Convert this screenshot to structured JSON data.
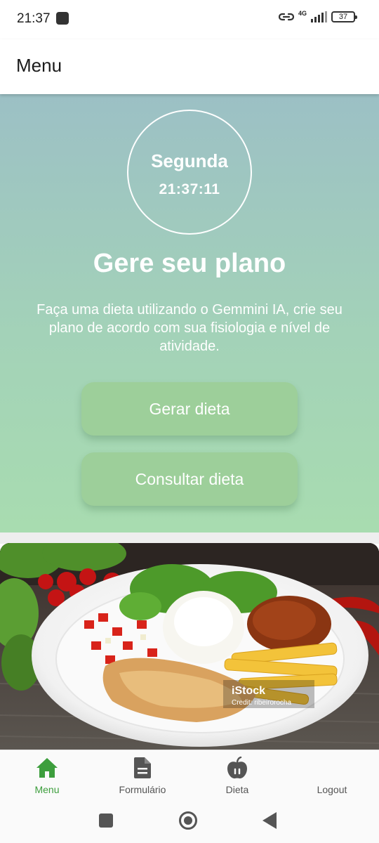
{
  "status_bar": {
    "time": "21:37",
    "network": "4G",
    "battery": "37"
  },
  "app_bar": {
    "title": "Menu"
  },
  "hero": {
    "day": "Segunda",
    "clock": "21:37:11",
    "title": "Gere seu plano",
    "description": "Faça uma dieta utilizando o Gemmini IA, crie seu plano de acordo com sua fisiologia e nível de atividade.",
    "buttons": {
      "generate": "Gerar dieta",
      "consult": "Consultar dieta"
    }
  },
  "food_image": {
    "watermark": "iStock",
    "credit": "Credit: ribeirorocha"
  },
  "bottom_nav": {
    "items": [
      {
        "label": "Menu",
        "icon": "home-icon",
        "active": true
      },
      {
        "label": "Formulário",
        "icon": "document-icon",
        "active": false
      },
      {
        "label": "Dieta",
        "icon": "apple-icon",
        "active": false
      },
      {
        "label": "Logout",
        "icon": "",
        "active": false
      }
    ]
  },
  "colors": {
    "accent": "#3d9e3d",
    "button": "#9dcf9a",
    "hero_top": "#9cc0c5",
    "hero_bottom": "#a8dcb0"
  }
}
